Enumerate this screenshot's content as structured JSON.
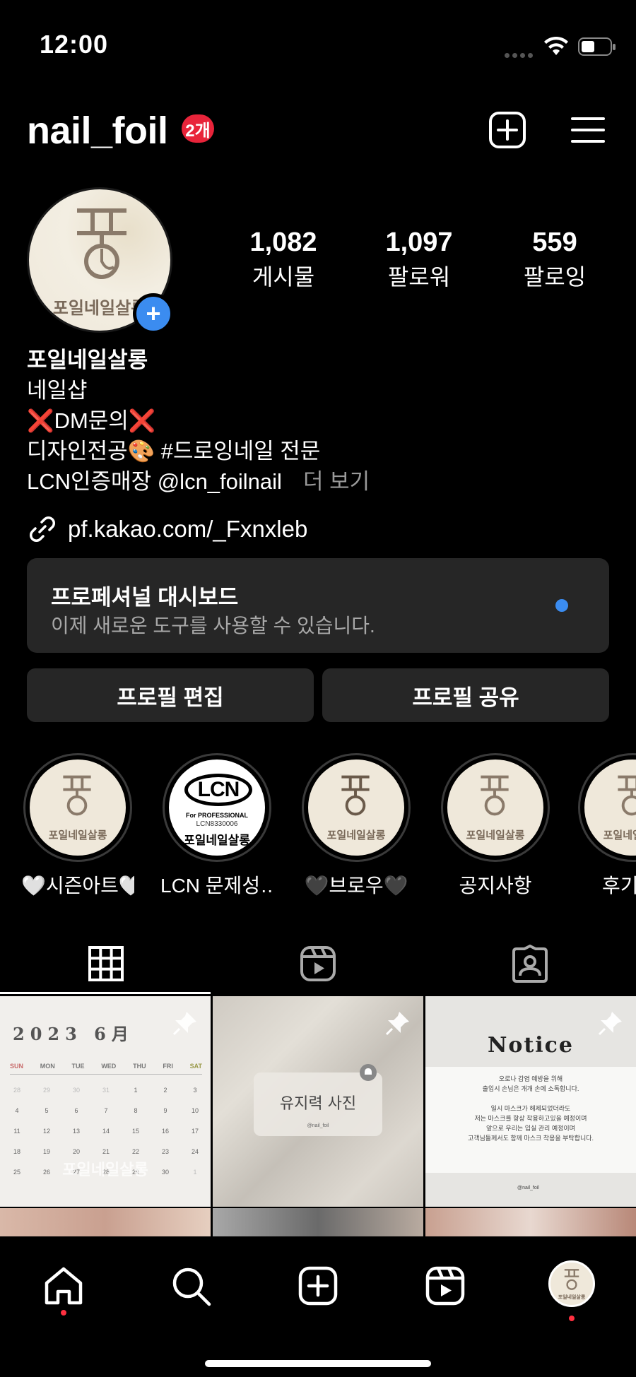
{
  "status_bar": {
    "time": "12:00"
  },
  "header": {
    "username": "nail_foil",
    "notification_badge": "2개"
  },
  "profile": {
    "avatar_text": "포일네일살롱",
    "stats": [
      {
        "value": "1,082",
        "label": "게시물"
      },
      {
        "value": "1,097",
        "label": "팔로워"
      },
      {
        "value": "559",
        "label": "팔로잉"
      }
    ],
    "name": "포일네일살롱",
    "bio_lines": [
      "네일샵",
      "❌DM문의❌",
      "디자인전공🎨 #드로잉네일 전문",
      "LCN인증매장 @lcn_foilnail"
    ],
    "more_label": "더 보기",
    "link": "pf.kakao.com/_Fxnxleb"
  },
  "dashboard": {
    "title": "프로페셔널 대시보드",
    "subtitle": "이제 새로운 도구를 사용할 수 있습니다."
  },
  "buttons": {
    "edit": "프로필 편집",
    "share": "프로필 공유"
  },
  "highlights": [
    {
      "label": "🤍시즌아트🤍",
      "cover_text": "포일네일살롱"
    },
    {
      "label": "LCN 문제성…",
      "cover_logo": "LCN",
      "cover_sub1": "For PROFESSIONAL",
      "cover_sub2": "LCN8330006",
      "cover_text": "포일네일살롱"
    },
    {
      "label": "🖤브로우🖤",
      "cover_text": "포일네일살롱"
    },
    {
      "label": "공지사항",
      "cover_text": "포일네일살롱"
    },
    {
      "label": "후기",
      "cover_text": "포일네일살롱"
    }
  ],
  "posts": {
    "calendar": {
      "title": "2023 6月",
      "weekdays": [
        "SUN",
        "MON",
        "TUE",
        "WED",
        "THU",
        "FRI",
        "SAT"
      ],
      "weeks": [
        [
          "28",
          "29",
          "30",
          "31",
          "1",
          "2",
          "3"
        ],
        [
          "4",
          "5",
          "6",
          "7",
          "8",
          "9",
          "10"
        ],
        [
          "11",
          "12",
          "13",
          "14",
          "15",
          "16",
          "17"
        ],
        [
          "18",
          "19",
          "20",
          "21",
          "22",
          "23",
          "24"
        ],
        [
          "25",
          "26",
          "27",
          "28",
          "29",
          "30",
          "1"
        ]
      ],
      "watermark": "포일네일살롱"
    },
    "paper": {
      "title": "유지력 사진",
      "handle": "@nail_foil"
    },
    "notice": {
      "title": "Notice",
      "lines": [
        "오로나 감염 예방을 위해",
        "출입시 손님은 개개 손에 소독합니다.",
        "",
        "일시 마스크가 해제되었더라도",
        "저는 마스크를 항상 착용하고있을 예정이며",
        "앞으로 우리는 입실 관리 예정이며",
        "고객님들께서도 함께 마스크 착용을 부탁합니다."
      ],
      "handle": "@nail_foil"
    }
  },
  "nav": {
    "avatar_text": "포일네일살롱"
  }
}
